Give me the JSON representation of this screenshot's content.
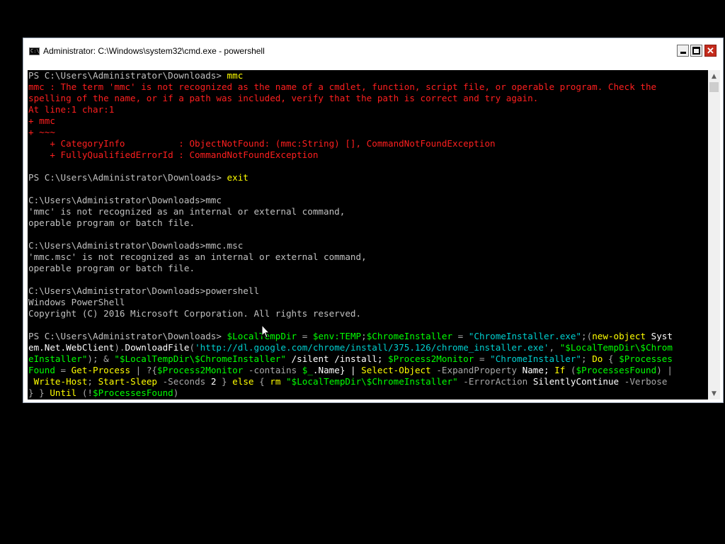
{
  "window": {
    "title": "Administrator: C:\\Windows\\system32\\cmd.exe - powershell",
    "app_icon_label": "C:\\"
  },
  "controls": {
    "close_glyph": "✕"
  },
  "scrollbar": {
    "up_arrow": "▲",
    "down_arrow": "▼"
  },
  "colors": {
    "default": "#c0c0c0",
    "error": "#ff1f1f",
    "yellow": "#ffff00",
    "cmdlet": "#ffff00",
    "variable": "#00ff00",
    "string": "#00cfcf",
    "param": "#a8a8a8",
    "white": "#ffffff"
  },
  "console": {
    "lines": [
      [
        {
          "t": "PS C:\\Users\\Administrator\\Downloads> ",
          "c": "default"
        },
        {
          "t": "mmc",
          "c": "yellow"
        }
      ],
      [
        {
          "t": "mmc : The term 'mmc' is not recognized as the name of a cmdlet, function, script file, or operable program. Check the",
          "c": "error"
        }
      ],
      [
        {
          "t": "spelling of the name, or if a path was included, verify that the path is correct and try again.",
          "c": "error"
        }
      ],
      [
        {
          "t": "At line:1 char:1",
          "c": "error"
        }
      ],
      [
        {
          "t": "+ mmc",
          "c": "error"
        }
      ],
      [
        {
          "t": "+ ~~~",
          "c": "error"
        }
      ],
      [
        {
          "t": "    + CategoryInfo          : ObjectNotFound: (mmc:String) [], CommandNotFoundException",
          "c": "error"
        }
      ],
      [
        {
          "t": "    + FullyQualifiedErrorId : CommandNotFoundException",
          "c": "error"
        }
      ],
      [
        {
          "t": "",
          "c": "default"
        }
      ],
      [
        {
          "t": "PS C:\\Users\\Administrator\\Downloads> ",
          "c": "default"
        },
        {
          "t": "exit",
          "c": "yellow"
        }
      ],
      [
        {
          "t": "",
          "c": "default"
        }
      ],
      [
        {
          "t": "C:\\Users\\Administrator\\Downloads>mmc",
          "c": "default"
        }
      ],
      [
        {
          "t": "'mmc' is not recognized as an internal or external command,",
          "c": "default"
        }
      ],
      [
        {
          "t": "operable program or batch file.",
          "c": "default"
        }
      ],
      [
        {
          "t": "",
          "c": "default"
        }
      ],
      [
        {
          "t": "C:\\Users\\Administrator\\Downloads>mmc.msc",
          "c": "default"
        }
      ],
      [
        {
          "t": "'mmc.msc' is not recognized as an internal or external command,",
          "c": "default"
        }
      ],
      [
        {
          "t": "operable program or batch file.",
          "c": "default"
        }
      ],
      [
        {
          "t": "",
          "c": "default"
        }
      ],
      [
        {
          "t": "C:\\Users\\Administrator\\Downloads>powershell",
          "c": "default"
        }
      ],
      [
        {
          "t": "Windows PowerShell",
          "c": "default"
        }
      ],
      [
        {
          "t": "Copyright (C) 2016 Microsoft Corporation. All rights reserved.",
          "c": "default"
        }
      ],
      [
        {
          "t": "",
          "c": "default"
        }
      ],
      [
        {
          "t": "PS C:\\Users\\Administrator\\Downloads> ",
          "c": "default"
        },
        {
          "t": "$LocalTempDir",
          "c": "variable"
        },
        {
          "t": " = ",
          "c": "param"
        },
        {
          "t": "$env:TEMP",
          "c": "variable"
        },
        {
          "t": ";",
          "c": "param"
        },
        {
          "t": "$ChromeInstaller",
          "c": "variable"
        },
        {
          "t": " = ",
          "c": "param"
        },
        {
          "t": "\"ChromeInstaller.exe\"",
          "c": "string"
        },
        {
          "t": ";(",
          "c": "param"
        },
        {
          "t": "new-object",
          "c": "cmdlet"
        },
        {
          "t": " Syst",
          "c": "white"
        }
      ],
      [
        {
          "t": "em.Net.WebClient",
          "c": "white"
        },
        {
          "t": ").",
          "c": "param"
        },
        {
          "t": "DownloadFile",
          "c": "white"
        },
        {
          "t": "(",
          "c": "param"
        },
        {
          "t": "'http://dl.google.com/chrome/install/375.126/chrome_installer.exe'",
          "c": "string"
        },
        {
          "t": ", ",
          "c": "param"
        },
        {
          "t": "\"$LocalTempDir\\$Chrom",
          "c": "variable"
        }
      ],
      [
        {
          "t": "eInstaller\"",
          "c": "variable"
        },
        {
          "t": "); & ",
          "c": "param"
        },
        {
          "t": "\"$LocalTempDir\\$ChromeInstaller\"",
          "c": "variable"
        },
        {
          "t": " /silent /install; ",
          "c": "white"
        },
        {
          "t": "$Process2Monitor",
          "c": "variable"
        },
        {
          "t": " = ",
          "c": "param"
        },
        {
          "t": "\"ChromeInstaller\"",
          "c": "string"
        },
        {
          "t": "; ",
          "c": "param"
        },
        {
          "t": "Do",
          "c": "cmdlet"
        },
        {
          "t": " { ",
          "c": "param"
        },
        {
          "t": "$Processes",
          "c": "variable"
        }
      ],
      [
        {
          "t": "Found",
          "c": "variable"
        },
        {
          "t": " = ",
          "c": "param"
        },
        {
          "t": "Get-Process",
          "c": "cmdlet"
        },
        {
          "t": " | ?{",
          "c": "param"
        },
        {
          "t": "$Process2Monitor",
          "c": "variable"
        },
        {
          "t": " -contains ",
          "c": "param"
        },
        {
          "t": "$_",
          "c": "variable"
        },
        {
          "t": ".Name} | ",
          "c": "white"
        },
        {
          "t": "Select-Object",
          "c": "cmdlet"
        },
        {
          "t": " -ExpandProperty ",
          "c": "param"
        },
        {
          "t": "Name; ",
          "c": "white"
        },
        {
          "t": "If",
          "c": "cmdlet"
        },
        {
          "t": " (",
          "c": "param"
        },
        {
          "t": "$ProcessesFound",
          "c": "variable"
        },
        {
          "t": ") |",
          "c": "param"
        }
      ],
      [
        {
          "t": " ",
          "c": "param"
        },
        {
          "t": "Write-Host",
          "c": "cmdlet"
        },
        {
          "t": "; ",
          "c": "param"
        },
        {
          "t": "Start-Sleep",
          "c": "cmdlet"
        },
        {
          "t": " -Seconds ",
          "c": "param"
        },
        {
          "t": "2",
          "c": "white"
        },
        {
          "t": " } ",
          "c": "param"
        },
        {
          "t": "else",
          "c": "cmdlet"
        },
        {
          "t": " { ",
          "c": "param"
        },
        {
          "t": "rm",
          "c": "cmdlet"
        },
        {
          "t": " ",
          "c": "param"
        },
        {
          "t": "\"$LocalTempDir\\$ChromeInstaller\"",
          "c": "variable"
        },
        {
          "t": " -ErrorAction ",
          "c": "param"
        },
        {
          "t": "SilentlyContinue",
          "c": "white"
        },
        {
          "t": " -Verbose",
          "c": "param"
        }
      ],
      [
        {
          "t": "} } ",
          "c": "param"
        },
        {
          "t": "Until",
          "c": "cmdlet"
        },
        {
          "t": " (!",
          "c": "param"
        },
        {
          "t": "$ProcessesFound",
          "c": "variable"
        },
        {
          "t": ")",
          "c": "param"
        }
      ]
    ]
  }
}
